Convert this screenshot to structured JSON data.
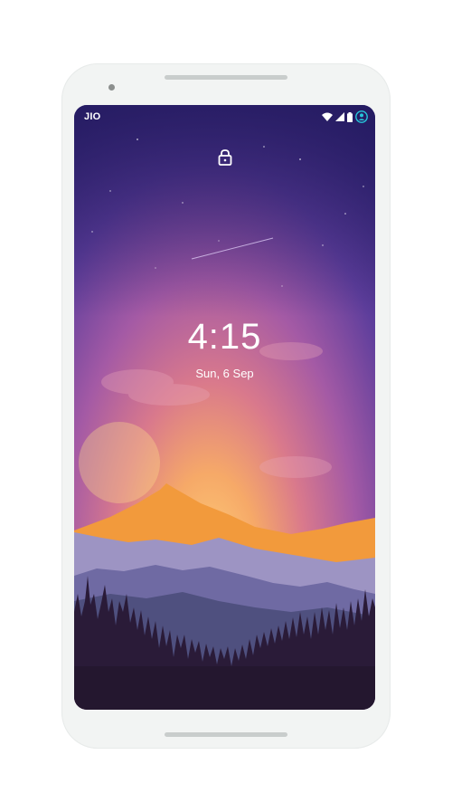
{
  "status_bar": {
    "carrier": "JIO"
  },
  "lock_screen": {
    "time": "4:15",
    "date": "Sun, 6 Sep"
  },
  "colors": {
    "sky_top": "#2a1f6e",
    "sky_mid": "#7b4aa8",
    "horizon": "#f0a24a",
    "accent_user": "#26c6da"
  },
  "icons": [
    "lock-icon",
    "wifi-icon",
    "signal-icon",
    "battery-icon",
    "user-icon"
  ]
}
